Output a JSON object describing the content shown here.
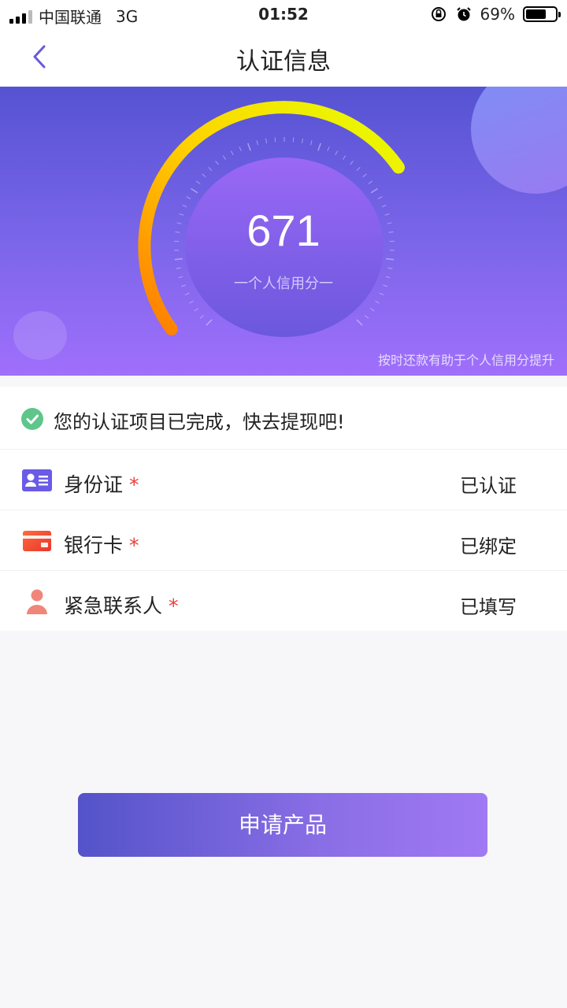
{
  "status_bar": {
    "carrier": "中国联通",
    "network": "3G",
    "time": "01:52",
    "battery_percent": "69%",
    "battery_level": 0.69
  },
  "nav": {
    "title": "认证信息"
  },
  "hero": {
    "score": "671",
    "score_label": "一个人信用分一",
    "tip": "按时还款有助于个人信用分提升"
  },
  "success": {
    "text": "您的认证项目已完成，快去提现吧!"
  },
  "items": [
    {
      "label": "身份证",
      "required_mark": "*",
      "status": "已认证",
      "icon": "id-card-icon"
    },
    {
      "label": "银行卡",
      "required_mark": "*",
      "status": "已绑定",
      "icon": "bank-card-icon"
    },
    {
      "label": "紧急联系人",
      "required_mark": "*",
      "status": "已填写",
      "icon": "contact-person-icon"
    }
  ],
  "apply_button": {
    "label": "申请产品"
  },
  "colors": {
    "accent": "#6a5ad8",
    "success": "#5fc58a",
    "required": "#e83f3f"
  }
}
